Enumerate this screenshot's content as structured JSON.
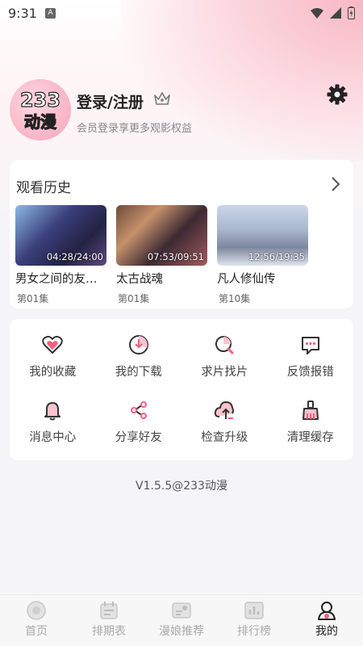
{
  "status_bar": {
    "time": "9:31",
    "sim_label": "A"
  },
  "profile": {
    "avatar_text_top": "233",
    "avatar_text_bottom": "动漫",
    "login_title": "登录/注册",
    "login_sub": "会员登录享更多观影权益"
  },
  "history": {
    "title": "观看历史",
    "items": [
      {
        "name": "男女之间的友…",
        "time": "04:28/24:00",
        "episode": "第01集"
      },
      {
        "name": "太古战魂",
        "time": "07:53/09:51",
        "episode": "第01集"
      },
      {
        "name": "凡人修仙传",
        "time": "12:56/19:35",
        "episode": "第10集"
      }
    ]
  },
  "menu": {
    "items": [
      {
        "label": "我的收藏",
        "icon": "heart-icon"
      },
      {
        "label": "我的下载",
        "icon": "download-icon"
      },
      {
        "label": "求片找片",
        "icon": "search-film-icon"
      },
      {
        "label": "反馈报错",
        "icon": "feedback-icon"
      },
      {
        "label": "消息中心",
        "icon": "bell-icon"
      },
      {
        "label": "分享好友",
        "icon": "share-icon"
      },
      {
        "label": "检查升级",
        "icon": "upgrade-icon"
      },
      {
        "label": "清理缓存",
        "icon": "broom-icon"
      }
    ]
  },
  "version": "V1.5.5@233动漫",
  "tabbar": {
    "tabs": [
      {
        "label": "首页",
        "icon": "home-icon"
      },
      {
        "label": "排期表",
        "icon": "calendar-icon"
      },
      {
        "label": "漫娘推荐",
        "icon": "recommend-icon"
      },
      {
        "label": "排行榜",
        "icon": "ranking-icon"
      },
      {
        "label": "我的",
        "icon": "profile-icon"
      }
    ],
    "active_index": 4
  },
  "colors": {
    "accent": "#f2607d",
    "accent_light": "#fbd4dc",
    "icon_dark": "#333333",
    "tab_inactive": "#aaaaaa"
  }
}
